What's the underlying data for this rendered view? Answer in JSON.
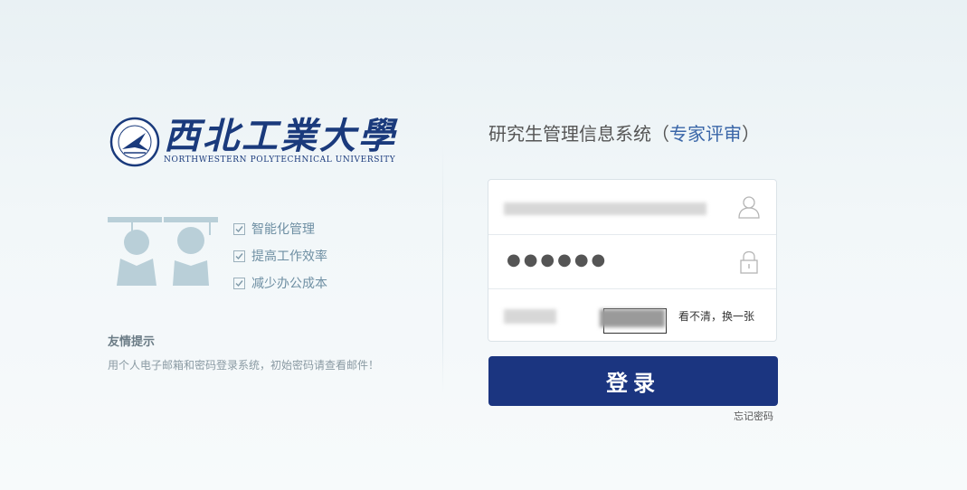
{
  "logo": {
    "name_cn": "西北工業大學",
    "name_en": "NORTHWESTERN POLYTECHNICAL UNIVERSITY"
  },
  "features": [
    {
      "label": "智能化管理",
      "icon": "check-icon"
    },
    {
      "label": "提高工作效率",
      "icon": "check-icon"
    },
    {
      "label": "减少办公成本",
      "icon": "check-icon"
    }
  ],
  "tip": {
    "title": "友情提示",
    "text": "用个人电子邮箱和密码登录系统，初始密码请查看邮件！"
  },
  "system": {
    "title": "研究生管理信息系统",
    "sub_open": "（",
    "sub": "专家评审",
    "sub_close": "）"
  },
  "form": {
    "password_mask": "●●●●●●",
    "captcha_refresh": "看不清，换一张",
    "username_icon": "user-icon",
    "password_icon": "lock-icon"
  },
  "login_label": "登录",
  "forgot_label": "忘记密码",
  "colors": {
    "brand": "#1b3580",
    "accent": "#3a66a8",
    "feature": "#6e8fa3"
  }
}
